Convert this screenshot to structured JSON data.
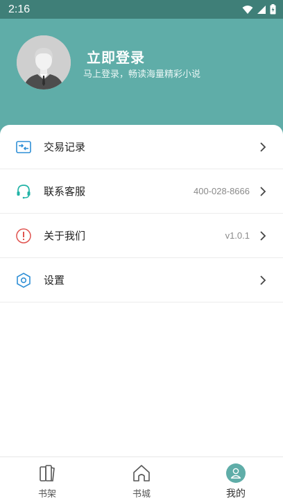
{
  "status_bar": {
    "time": "2:16"
  },
  "profile": {
    "title": "立即登录",
    "subtitle": "马上登录，畅读海量精彩小说"
  },
  "menu": [
    {
      "label": "交易记录",
      "value": "",
      "icon": "transaction-icon"
    },
    {
      "label": "联系客服",
      "value": "400-028-8666",
      "icon": "headset-icon"
    },
    {
      "label": "关于我们",
      "value": "v1.0.1",
      "icon": "info-icon"
    },
    {
      "label": "设置",
      "value": "",
      "icon": "settings-hexagon-icon"
    }
  ],
  "tabs": [
    {
      "label": "书架",
      "icon": "bookshelf-icon",
      "active": false
    },
    {
      "label": "书城",
      "icon": "home-icon",
      "active": false
    },
    {
      "label": "我的",
      "icon": "user-icon",
      "active": true
    }
  ],
  "colors": {
    "header": "#5fada8",
    "status_bar": "#3f7f78",
    "accent": "#5fada8",
    "transaction_icon": "#2f8fd6",
    "headset_icon": "#21b3a6",
    "info_icon": "#e0534f",
    "settings_icon": "#2f8fd6"
  }
}
